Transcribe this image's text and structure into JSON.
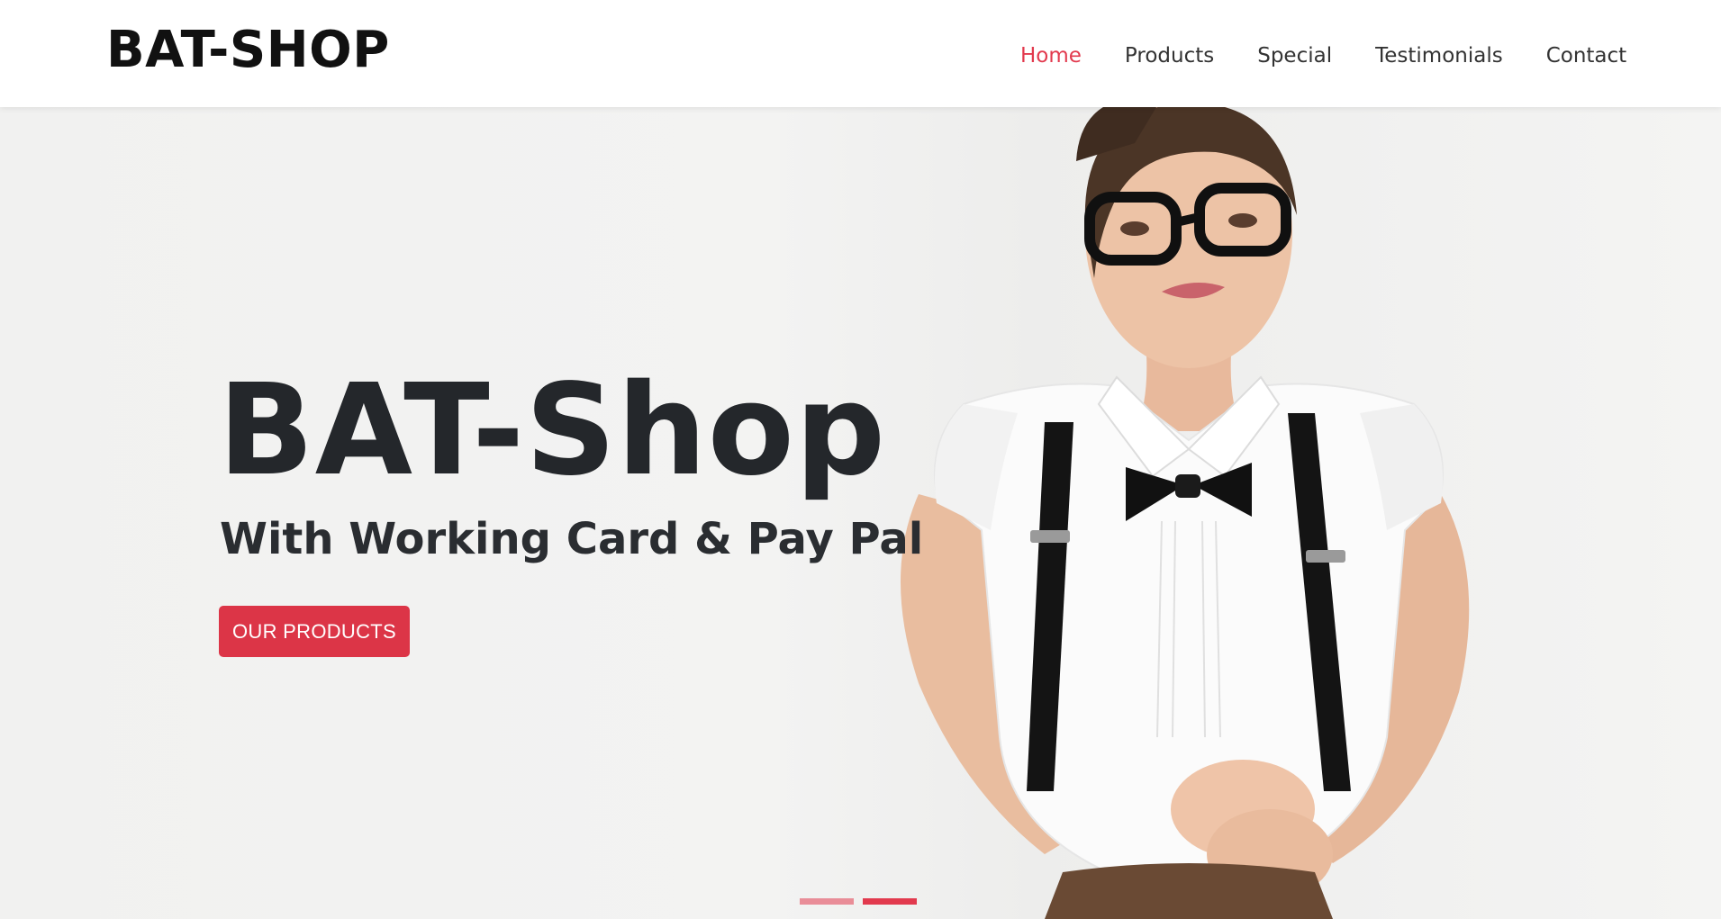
{
  "brand": "BAT-SHOP",
  "nav": {
    "items": [
      {
        "label": "Home",
        "active": true
      },
      {
        "label": "Products",
        "active": false
      },
      {
        "label": "Special",
        "active": false
      },
      {
        "label": "Testimonials",
        "active": false
      },
      {
        "label": "Contact",
        "active": false
      }
    ]
  },
  "hero": {
    "title": "BAT-Shop",
    "subtitle": "With Working Card & Pay Pal",
    "button_label": "OUR PRODUCTS",
    "slide_count": 2,
    "active_slide": 2
  },
  "colors": {
    "accent": "#dc3547",
    "active_link": "#e23a4e",
    "text_dark": "#24272b",
    "background": "#f2f2f1"
  }
}
